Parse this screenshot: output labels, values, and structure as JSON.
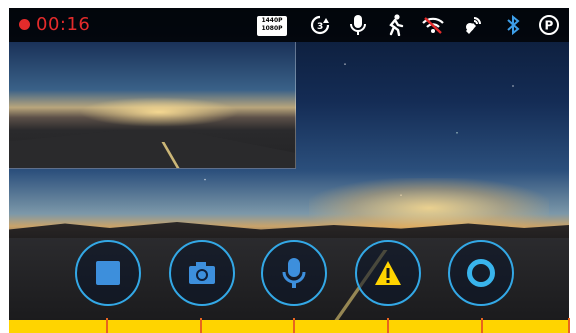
{
  "status": {
    "recording_time": "00:16",
    "resolution_line1": "1440P",
    "resolution_line2": "1080P",
    "icons": [
      "loop-recording-icon",
      "microphone-icon",
      "motion-detection-icon",
      "wifi-off-icon",
      "gps-icon",
      "bluetooth-icon",
      "parking-mode-icon"
    ]
  },
  "controls": [
    {
      "name": "stop-record-button",
      "icon": "stop-icon"
    },
    {
      "name": "snapshot-button",
      "icon": "camera-icon"
    },
    {
      "name": "mic-button",
      "icon": "microphone-icon"
    },
    {
      "name": "emergency-button",
      "icon": "warning-icon"
    },
    {
      "name": "assistant-button",
      "icon": "ring-icon"
    }
  ],
  "colors": {
    "accent": "#33a8e6",
    "record_red": "#e42b2b",
    "warning_yellow": "#ffd400",
    "callout_orange": "#e8641e"
  }
}
